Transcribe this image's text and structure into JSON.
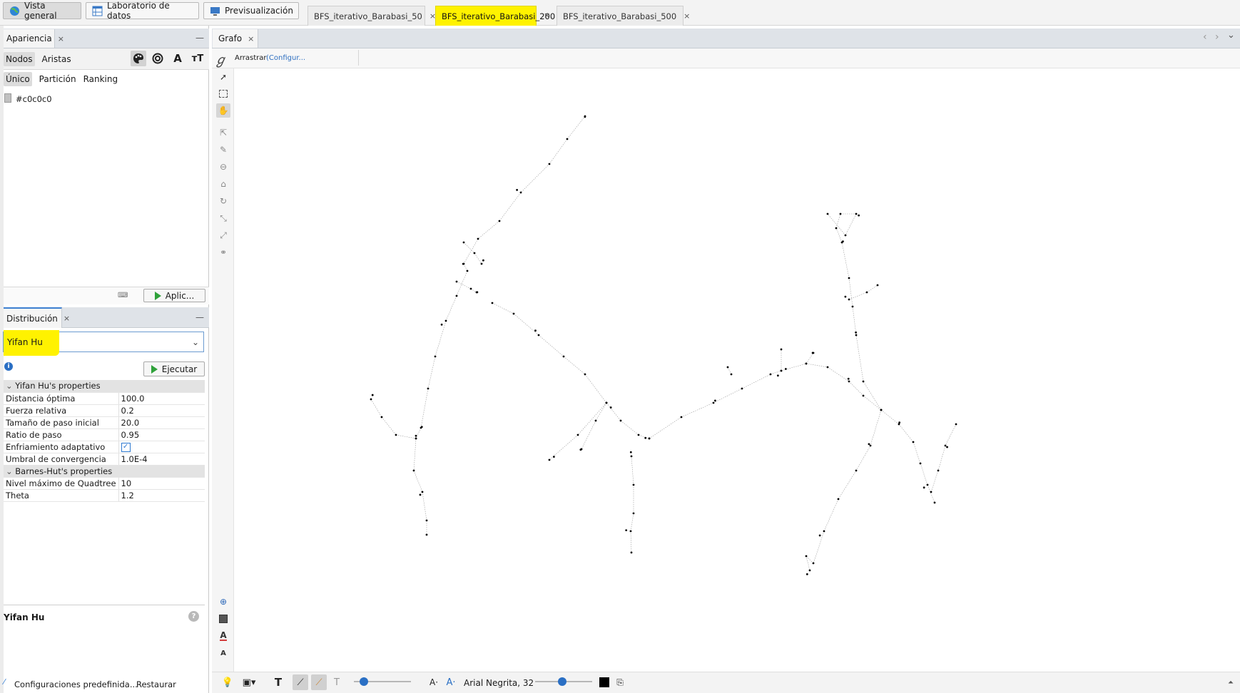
{
  "topbar": {
    "buttons": [
      {
        "label": "Vista general",
        "icon": "globe-icon"
      },
      {
        "label": "Laboratorio de datos",
        "icon": "table-icon"
      },
      {
        "label": "Previsualización",
        "icon": "monitor-icon"
      }
    ],
    "doc_tabs": [
      {
        "label": "BFS_iterativo_Barabasi_50",
        "selected": false
      },
      {
        "label": "BFS_iterativo_Barabasi_200",
        "selected": true
      },
      {
        "label": "BFS_iterativo_Barabasi_500",
        "selected": false
      }
    ],
    "close_glyph": "×",
    "highlight_color": "#fff200"
  },
  "appearance": {
    "tab_label": "Apariencia",
    "close_glyph": "×",
    "minimize_glyph": "—",
    "subtabs": [
      "Nodos",
      "Aristas"
    ],
    "modes": [
      "Único",
      "Partición",
      "Ranking"
    ],
    "color_value": "#c0c0c0",
    "node_color": "#c0c0c0",
    "apply_label": "Aplic...",
    "icons": [
      "palette-icon",
      "size-icon",
      "label-color-icon",
      "label-size-icon"
    ]
  },
  "distribution": {
    "tab_label": "Distribución",
    "close_glyph": "×",
    "minimize_glyph": "—",
    "algorithm": "Yifan Hu",
    "run_label": "Ejecutar",
    "info_glyph": "i",
    "groups": [
      {
        "name": "Yifan Hu's properties",
        "props": [
          {
            "key": "Distancia óptima",
            "value": "100.0"
          },
          {
            "key": "Fuerza relativa",
            "value": "0.2"
          },
          {
            "key": "Tamaño de paso inicial",
            "value": "20.0"
          },
          {
            "key": "Ratio de paso",
            "value": "0.95"
          },
          {
            "key": "Enfriamiento adaptativo",
            "value": "",
            "checked": true
          },
          {
            "key": "Umbral de convergencia",
            "value": "1.0E-4"
          }
        ]
      },
      {
        "name": "Barnes-Hut's properties",
        "props": [
          {
            "key": "Nivel máximo de Quadtree",
            "value": "10"
          },
          {
            "key": "Theta",
            "value": "1.2"
          }
        ]
      }
    ],
    "desc_title": "Yifan Hu",
    "help_glyph": "?",
    "presets_label": "Configuraciones predefinida...",
    "reset_label": "Restaurar"
  },
  "graph": {
    "tab_label": "Grafo",
    "close_glyph": "×",
    "drag_label": "Arrastrar",
    "config_label": "(Configur...",
    "font_label": "Arial Negrita, 32",
    "nav_left": "‹",
    "nav_right": "›",
    "nav_down": "⌄",
    "edge_color": "#9a9a9a",
    "node_color": "#000000"
  }
}
